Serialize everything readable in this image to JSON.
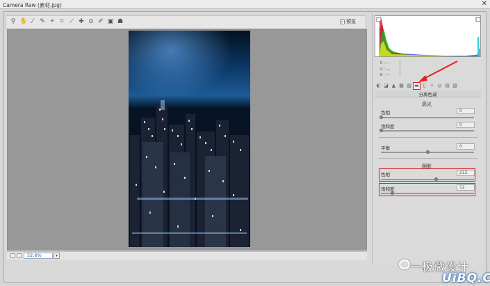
{
  "window": {
    "title": "Camera Raw (素材.jpg)",
    "close_glyph": "✕"
  },
  "toolbar": {
    "tools": [
      "zoom-tool-icon",
      "hand-tool-icon",
      "white-balance-icon",
      "color-sampler-icon",
      "target-adjust-icon",
      "crop-icon",
      "straighten-icon",
      "spot-removal-icon",
      "red-eye-icon",
      "brush-icon",
      "rotate-icon",
      "hand2-icon"
    ],
    "preview_label": "预览",
    "preview_checked": true
  },
  "histogram": {
    "colors": {
      "red": "#e01818",
      "green": "#12c012",
      "blue": "#1a3ce0",
      "yellow": "#e8e820",
      "cyan": "#30d0e0"
    }
  },
  "readout": {
    "r": "R :  ---",
    "g": "G :  ---",
    "b": "B :  ---"
  },
  "panel": {
    "title": "分离色调",
    "highlights": {
      "heading": "高光",
      "hue_label": "色相",
      "hue_value": "0",
      "sat_label": "饱和度",
      "sat_value": "0"
    },
    "balance": {
      "label": "平衡",
      "value": "0"
    },
    "shadows": {
      "heading": "阴影",
      "hue_label": "色相",
      "hue_value": "212",
      "sat_label": "饱和度",
      "sat_value": "12"
    }
  },
  "status": {
    "zoom": "52.6%",
    "zoom_arrow": "▾"
  },
  "watermark": {
    "text": "一极微设计",
    "brand": "UiBQ.CoM"
  },
  "colors": {
    "highlight": "#e02020",
    "accent": "#2458a0"
  }
}
